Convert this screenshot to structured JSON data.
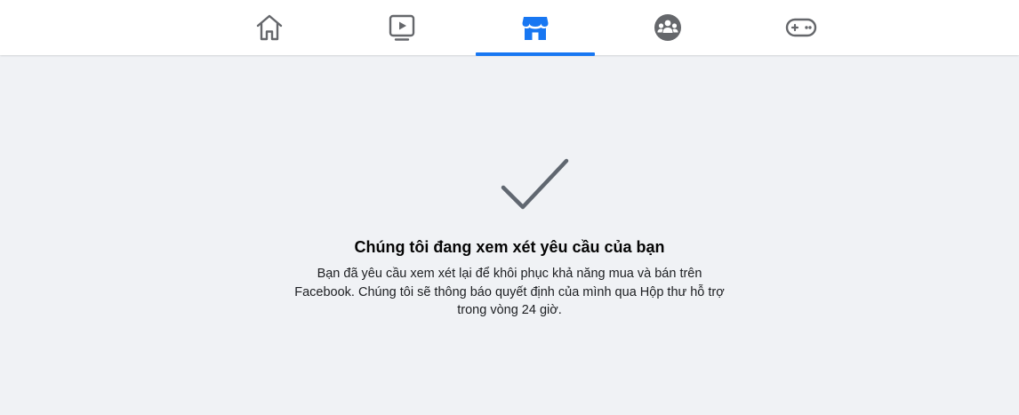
{
  "nav": {
    "tabs": [
      {
        "id": "home",
        "icon": "home-icon",
        "active": false
      },
      {
        "id": "watch",
        "icon": "watch-video-icon",
        "active": false
      },
      {
        "id": "marketplace",
        "icon": "marketplace-store-icon",
        "active": true
      },
      {
        "id": "groups",
        "icon": "groups-icon",
        "active": false
      },
      {
        "id": "gaming",
        "icon": "gamepad-icon",
        "active": false
      }
    ],
    "active_color": "#1877f2",
    "inactive_color": "#65676b"
  },
  "status": {
    "icon": "checkmark-icon",
    "title": "Chúng tôi đang xem xét yêu cầu của bạn",
    "description": "Bạn đã yêu cầu xem xét lại để khôi phục khả năng mua và bán trên Facebook. Chúng tôi sẽ thông báo quyết định của mình qua Hộp thư hỗ trợ trong vòng 24 giờ."
  }
}
